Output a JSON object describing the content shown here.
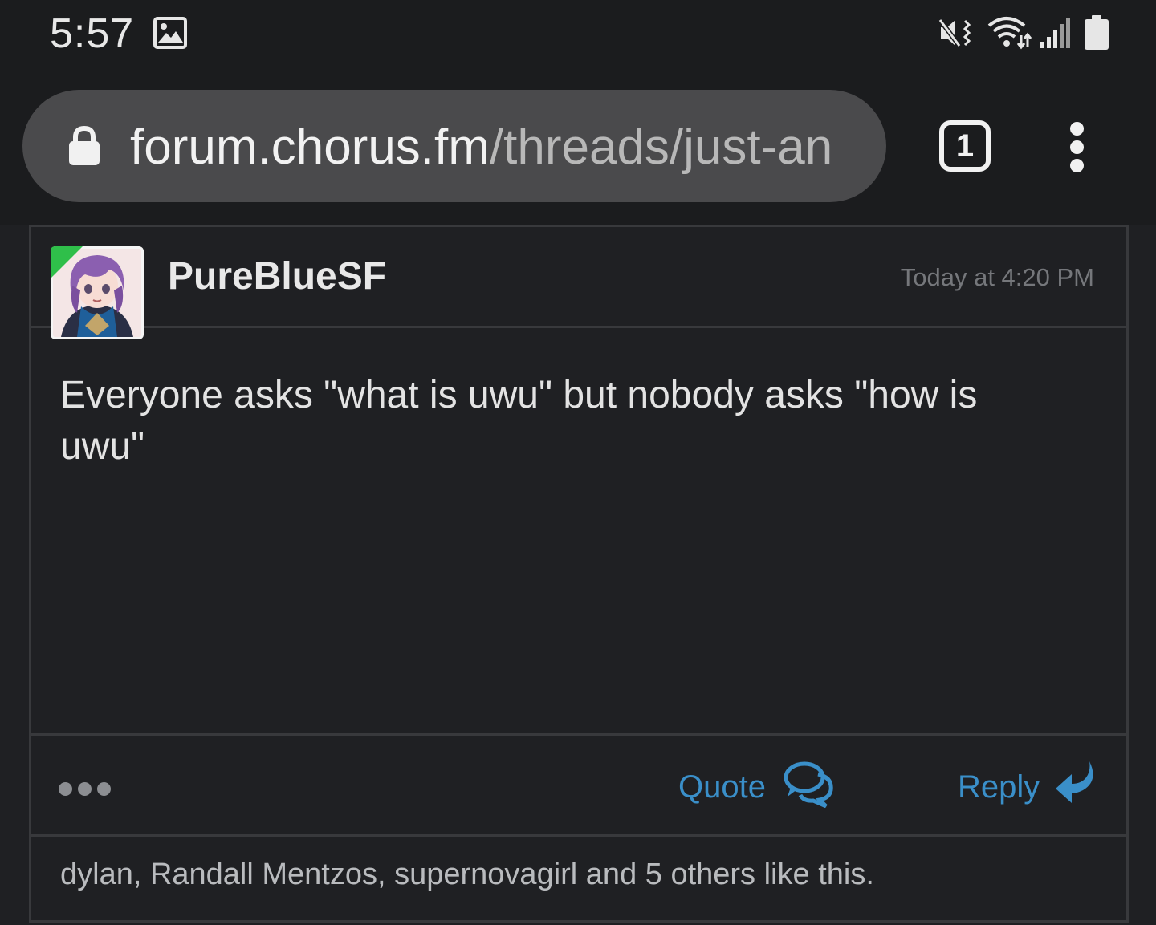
{
  "status_bar": {
    "time": "5:57",
    "icons": [
      "gallery-icon",
      "mute-vibrate-icon",
      "wifi-icon",
      "signal-icon",
      "battery-icon"
    ]
  },
  "browser": {
    "url_host": "forum.chorus.fm",
    "url_path": "/threads/just-an",
    "tab_count": "1",
    "icons": [
      "lock-icon",
      "tabs-icon",
      "menu-icon"
    ]
  },
  "post": {
    "username": "PureBlueSF",
    "timestamp": "Today at 4:20 PM",
    "body": "Everyone asks \"what is uwu\" but nobody asks \"how is uwu\"",
    "actions": {
      "quote_label": "Quote",
      "reply_label": "Reply"
    },
    "likes": "dylan, Randall Mentzos, supernovagirl and 5 others like this.",
    "colors": {
      "link": "#3a8fc9",
      "online": "#2fbf4a",
      "background": "#1f2023"
    }
  }
}
